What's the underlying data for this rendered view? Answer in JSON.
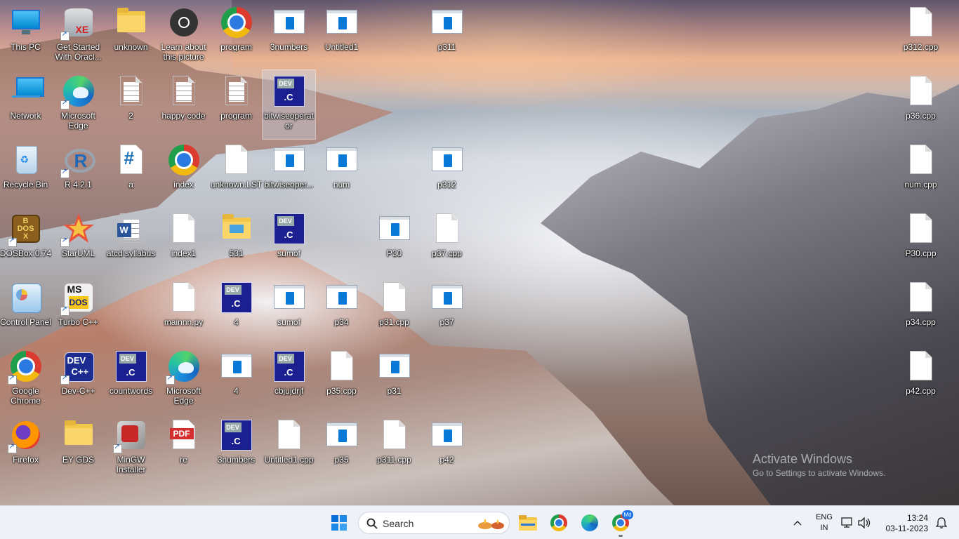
{
  "desktop": {
    "icons": [
      {
        "label": "This PC",
        "kind": "monitor",
        "shortcut": false
      },
      {
        "label": "Get Started With Oracl...",
        "kind": "oracle",
        "shortcut": true
      },
      {
        "label": "unknown",
        "kind": "folder",
        "shortcut": false
      },
      {
        "label": "Learn about this picture",
        "kind": "camera",
        "shortcut": false
      },
      {
        "label": "program",
        "kind": "chrome",
        "shortcut": false
      },
      {
        "label": "3numbers",
        "kind": "winapp",
        "shortcut": false
      },
      {
        "label": "Untitled1",
        "kind": "winapp",
        "shortcut": false
      },
      {
        "label": "p311",
        "kind": "winapp",
        "shortcut": false
      },
      {
        "label": "p312.cpp",
        "kind": "doc",
        "shortcut": false
      },
      {
        "label": "Network",
        "kind": "network",
        "shortcut": false
      },
      {
        "label": "Microsoft Edge",
        "kind": "edge",
        "shortcut": true
      },
      {
        "label": "2",
        "kind": "doclines",
        "shortcut": false
      },
      {
        "label": "happy code",
        "kind": "doclines",
        "shortcut": false
      },
      {
        "label": "program",
        "kind": "doclines",
        "shortcut": false
      },
      {
        "label": "bitwiseoperator",
        "kind": "devc",
        "shortcut": false
      },
      {
        "label": "p36.cpp",
        "kind": "doc",
        "shortcut": false
      },
      {
        "label": "Recycle Bin",
        "kind": "recycle",
        "shortcut": false
      },
      {
        "label": "R 4.2.1",
        "kind": "rlang",
        "shortcut": true
      },
      {
        "label": "a",
        "kind": "csharp",
        "shortcut": false
      },
      {
        "label": "index",
        "kind": "chrome",
        "shortcut": false
      },
      {
        "label": "unknown.LST",
        "kind": "doc",
        "shortcut": false
      },
      {
        "label": "bitwiseoper...",
        "kind": "winapp",
        "shortcut": false
      },
      {
        "label": "num",
        "kind": "winapp",
        "shortcut": false
      },
      {
        "label": "p312",
        "kind": "winapp",
        "shortcut": false
      },
      {
        "label": "num.cpp",
        "kind": "doc",
        "shortcut": false
      },
      {
        "label": "DOSBox 0.74",
        "kind": "dosbox",
        "shortcut": true
      },
      {
        "label": "StarUML",
        "kind": "staruml",
        "shortcut": true
      },
      {
        "label": "atcd syllabus",
        "kind": "word",
        "shortcut": false
      },
      {
        "label": "index1",
        "kind": "doc",
        "shortcut": false
      },
      {
        "label": "531",
        "kind": "folderimg",
        "shortcut": false
      },
      {
        "label": "sumof",
        "kind": "devc",
        "shortcut": false
      },
      {
        "label": "P30",
        "kind": "winapp",
        "shortcut": false
      },
      {
        "label": "p37.cpp",
        "kind": "doc",
        "shortcut": false
      },
      {
        "label": "P30.cpp",
        "kind": "doc",
        "shortcut": false
      },
      {
        "label": "Control Panel",
        "kind": "controlpanel",
        "shortcut": false
      },
      {
        "label": "Turbo C++",
        "kind": "turbo",
        "shortcut": true
      },
      {
        "label": "mainnn.py",
        "kind": "doc",
        "shortcut": false
      },
      {
        "label": "4",
        "kind": "devc",
        "shortcut": false
      },
      {
        "label": "sumof",
        "kind": "winapp",
        "shortcut": false
      },
      {
        "label": "p34",
        "kind": "winapp",
        "shortcut": false
      },
      {
        "label": "p31.cpp",
        "kind": "doc",
        "shortcut": false
      },
      {
        "label": "p37",
        "kind": "winapp",
        "shortcut": false
      },
      {
        "label": "p34.cpp",
        "kind": "doc",
        "shortcut": false
      },
      {
        "label": "Google Chrome",
        "kind": "chrome",
        "shortcut": true
      },
      {
        "label": "Dev-C++",
        "kind": "devcpp",
        "shortcut": true
      },
      {
        "label": "countwords",
        "kind": "devc",
        "shortcut": false
      },
      {
        "label": "Microsoft Edge",
        "kind": "edge",
        "shortcut": true
      },
      {
        "label": "4",
        "kind": "winapp",
        "shortcut": false
      },
      {
        "label": "cbjujdrjf",
        "kind": "devc",
        "shortcut": false
      },
      {
        "label": "p35.cpp",
        "kind": "doc",
        "shortcut": false
      },
      {
        "label": "p31",
        "kind": "winapp",
        "shortcut": false
      },
      {
        "label": "p42.cpp",
        "kind": "doc",
        "shortcut": false
      },
      {
        "label": "Firefox",
        "kind": "firefox",
        "shortcut": true
      },
      {
        "label": "EY GDS",
        "kind": "folder",
        "shortcut": false
      },
      {
        "label": "MinGW Installer",
        "kind": "mingw",
        "shortcut": true
      },
      {
        "label": "re",
        "kind": "pdf",
        "shortcut": false
      },
      {
        "label": "3numbers",
        "kind": "devc",
        "shortcut": false
      },
      {
        "label": "Untitled1.cpp",
        "kind": "doc",
        "shortcut": false
      },
      {
        "label": "p35",
        "kind": "winapp",
        "shortcut": false
      },
      {
        "label": "p311.cpp",
        "kind": "doc",
        "shortcut": false
      },
      {
        "label": "p42",
        "kind": "winapp",
        "shortcut": false
      }
    ],
    "watermark_line1": "Activate Windows",
    "watermark_line2": "Go to Settings to activate Windows."
  },
  "taskbar": {
    "search_placeholder": "Search",
    "pdf_label": "PDF",
    "dev_label": "DEV",
    "c_label": ".C",
    "tray": {
      "lang_top": "ENG",
      "lang_bottom": "IN",
      "time": "13:24",
      "date": "03-11-2023",
      "chrome_badge": "Md"
    }
  }
}
